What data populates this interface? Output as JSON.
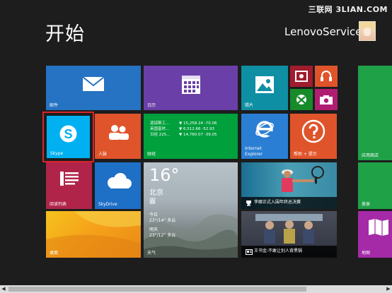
{
  "header": {
    "title": "开始",
    "user_name": "LenovoService"
  },
  "watermark": "三联网 3LIAN.COM",
  "tiles": {
    "mail": "邮件",
    "calendar": "日历",
    "photos": "照片",
    "skype": "Skype",
    "people": "人脉",
    "finance": {
      "label": "财经",
      "rows": [
        {
          "name": "道琼斯工...",
          "value": "▼ 15,258.24 -70.06"
        },
        {
          "name": "英国富时...",
          "value": "▼ 6,512.66 -52.93"
        },
        {
          "name": "日经 225...",
          "value": "▼ 14,760.07 -39.05"
        }
      ]
    },
    "ie": {
      "line1": "Internet",
      "line2": "Explorer"
    },
    "help": "帮助 + 提示",
    "store": "应用商店",
    "reading_list": "阅读列表",
    "skydrive": "SkyDrive",
    "weather": {
      "temperature": "16°",
      "city": "北京",
      "condition": "霾",
      "today_label": "今日",
      "today": "23°/14° 多云",
      "tomorrow_label": "明天",
      "tomorrow": "23°/12° 多云",
      "label": "天气"
    },
    "sports_news": "李娜正式入围年终总决赛",
    "news": "王书金:不敢让别人背黑锅",
    "desktop": "桌面",
    "food": "美食",
    "maps": "地图"
  },
  "colors": {
    "background": "#1d1d1d",
    "mail": "#2672c3",
    "calendar": "#6a3fa8",
    "photos": "#0f8fa3",
    "skype": "#00b0f0",
    "people": "#e0542b",
    "finance": "#00a03c",
    "ie": "#2a7fd4",
    "help": "#e0542b",
    "store": "#1fa148",
    "reading_list": "#b0244a",
    "skydrive": "#1e6fc6",
    "selection": "#d9252b"
  },
  "scrollbar": {
    "left_arrow": "◀",
    "right_arrow": "▶"
  }
}
